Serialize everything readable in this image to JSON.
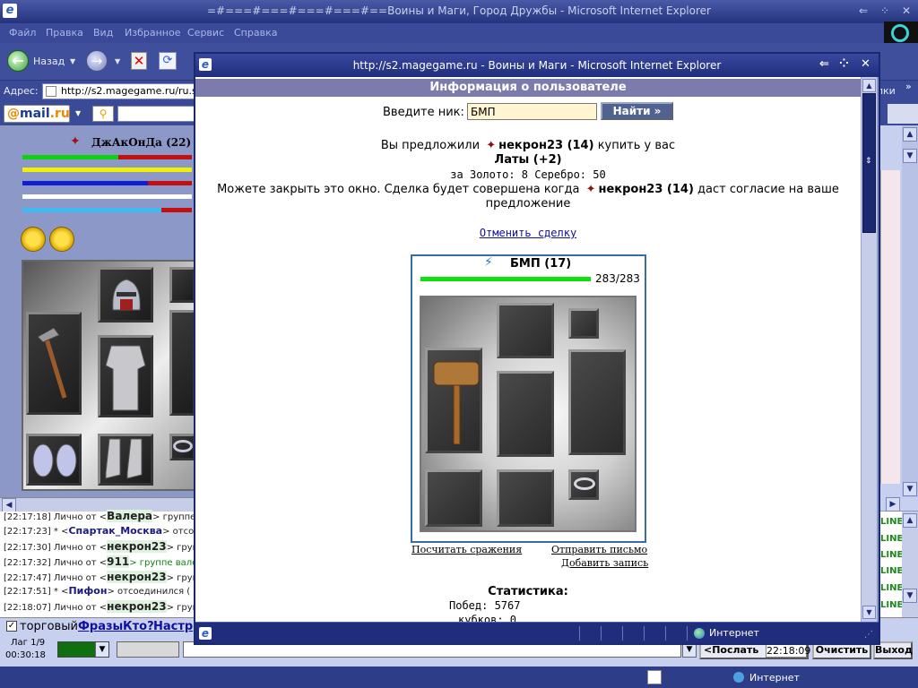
{
  "bg_window": {
    "title": "=#===#===#===#===#==Воины и Маги, Город Дружбы - Microsoft Internet Explorer",
    "menu": [
      "Файл",
      "Правка",
      "Вид",
      "Избранное",
      "Сервис",
      "Справка"
    ],
    "back_label": "Назад",
    "address_label": "Адрес:",
    "address_value": "http://s2.magegame.ru/ru.spb",
    "links_label": "лки",
    "mailru_at": "@",
    "mailru_mail": "mail",
    "mailru_ru": ".ru",
    "status_net": "Интернет"
  },
  "player": {
    "name": "ДжАкОнДа",
    "level": "(22)",
    "in": "In"
  },
  "chat": {
    "lines": [
      {
        "time": "[22:17:18]",
        "pre": "Лично от <",
        "nick": "Валера",
        "post": "> группе"
      },
      {
        "time": "[22:17:23]",
        "pre": "* <",
        "nick": "Спартак_Москва",
        "post": "> отсое"
      },
      {
        "time": "[22:17:30]",
        "pre": "Лично от <",
        "nick": "некрон23",
        "post": "> групп"
      },
      {
        "time": "[22:17:32]",
        "pre": "Лично от <",
        "nick": "911",
        "post": "> группе вале"
      },
      {
        "time": "[22:17:47]",
        "pre": "Лично от <",
        "nick": "некрон23",
        "post": "> групп"
      },
      {
        "time": "[22:17:51]",
        "pre": "* <",
        "nick": "Пифон",
        "post": "> отсоединился ("
      },
      {
        "time": "[22:18:07]",
        "pre": "Лично от <",
        "nick": "некрон23",
        "post": "> групп"
      }
    ],
    "online_label": "LINE"
  },
  "bottom": {
    "check_mark": "✓",
    "trade_label": "торговый",
    "phrases": "Фразы",
    "who": "Кто?",
    "settings": "Настр",
    "lag": "Лаг 1/9",
    "timer": "00:30:18",
    "send": "<Послать",
    "clock": "22:18:09",
    "clear": "Очистить",
    "exit": "Выход"
  },
  "popup": {
    "title": "http://s2.magegame.ru - Воины и Маги - Microsoft Internet Explorer",
    "header": "Информация о пользователе",
    "nick_label": "Введите ник:",
    "nick_value": "БМП",
    "find_button": "Найти »",
    "offer_pre": "Вы предложили",
    "offer_who": "некрон23 (14)",
    "offer_post": "купить у вас",
    "item": "Латы (+2)",
    "price": "за Золото: 8 Серебро: 50",
    "close_pre": "Можете закрыть это окно. Сделка будет совершена когда",
    "close_who": "некрон23 (14)",
    "close_post": "даст согласие на ваше",
    "close_line2": "предложение",
    "cancel_link": "Отменить сделку",
    "char_name": "БМП (17)",
    "hp_text": "283/283",
    "hp_fraction": 1.0,
    "link_battles": "Посчитать сражения",
    "link_letter": "Отправить письмо",
    "link_add": "Добавить запись",
    "stats_title": "Статистика:",
    "wins": "Побед: 5767",
    "cups": "кубков: 0",
    "status_net": "Интернет"
  },
  "colors": {
    "title_bar": "#24337e",
    "accent_green": "#10e010",
    "panel_border": "#3a6aa8",
    "button_bg": "#52628f",
    "nick_input_bg": "#fff5d0"
  }
}
